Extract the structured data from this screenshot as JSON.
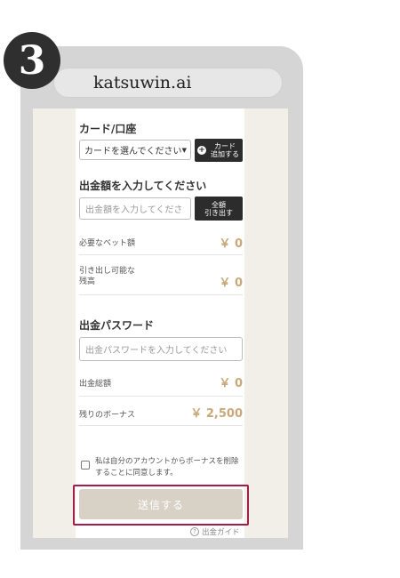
{
  "step": {
    "number": "3"
  },
  "browser": {
    "url": "katsuwin.ai"
  },
  "form": {
    "card_section_title": "カード/口座",
    "card_select_value": "カードを選んでください",
    "add_card_button": {
      "line1": "カード",
      "line2": "追加する"
    },
    "amount_section_title": "出金額を入力してください",
    "amount_placeholder": "出金額を入力してくださ",
    "withdraw_all_button": {
      "line1": "全額",
      "line2": "引き出す"
    },
    "required_bet_label": "必要なベット額",
    "required_bet_value": "￥ 0",
    "withdrawable_label_line1": "引き出し可能な",
    "withdrawable_label_line2": "残高",
    "withdrawable_value": "￥ 0",
    "password_section_title": "出金パスワード",
    "password_placeholder": "出金パスワードを入力してください",
    "total_label": "出金総額",
    "total_value": "￥ 0",
    "bonus_label": "残りのボーナス",
    "bonus_value": "￥ 2,500",
    "agree_text": "私は自分のアカウントからボーナスを削除することに同意します。",
    "submit_label": "送信する",
    "guide_label": "出金ガイド"
  },
  "colors": {
    "accent_gold": "#c8a87a",
    "highlight": "#a31d4a",
    "dark_button": "#2c2c2c"
  },
  "icons": {
    "add_card": "plus-circle-icon",
    "select_arrow": "chevron-down-icon",
    "guide": "question-circle-icon"
  }
}
